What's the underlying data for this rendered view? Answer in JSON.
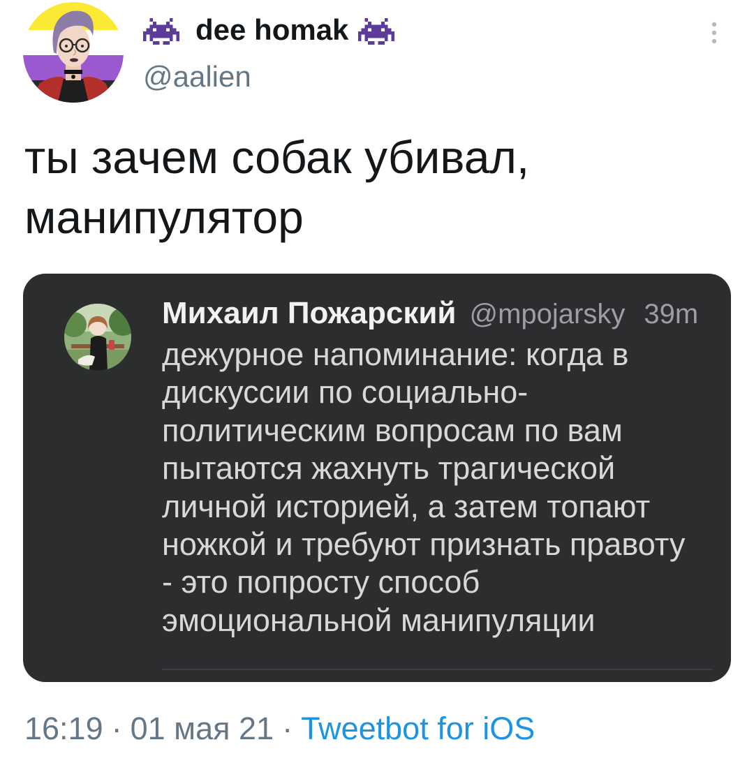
{
  "colors": {
    "page_bg": "#ffffff",
    "text_primary": "#14171a",
    "text_secondary": "#657786",
    "link": "#1b95e0",
    "card_bg": "#2c2d2f",
    "card_name": "#f2f2f2",
    "card_meta": "#9c9ea3",
    "card_body": "#d8d8d8",
    "badge_purple": "#5d3b9a"
  },
  "tweet": {
    "author": {
      "display_name": "dee homak",
      "handle": "@aalien",
      "name_badge_icon": "alien-monster-icon"
    },
    "menu_icon": "more-vertical-icon",
    "text": "ты зачем собак убивал, манипулятор",
    "attached_image": {
      "author_name": "Михаил Пожарский",
      "author_handle": "@mpojarsky",
      "time_ago": "39m",
      "body_lines": [
        "дежурное напоминание: когда в",
        "дискуссии по социально-",
        "политическим вопросам по вам",
        "пытаются жахнуть трагической",
        "личной историей, а затем топают",
        "ножкой и требуют признать правоту",
        "- это попросту способ",
        "эмоциональной манипуляции"
      ]
    },
    "footer": {
      "time": "16:19",
      "separator": "·",
      "date": "01 мая 21",
      "source": "Tweetbot for iOS"
    }
  }
}
